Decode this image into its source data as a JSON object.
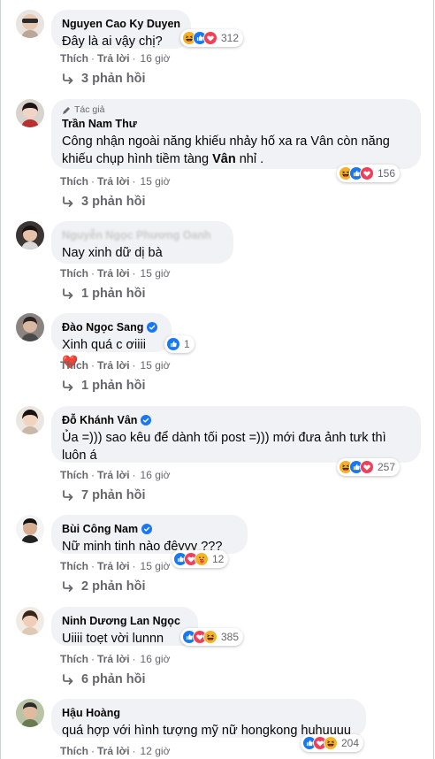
{
  "labels": {
    "like": "Thích",
    "reply": "Trả lời",
    "dot": "·",
    "author_tag": "Tác giả"
  },
  "colors": {
    "bubble": "#f0f2f5",
    "link": "#65676b",
    "verified": "#1877f2",
    "like": "#1877f2",
    "love": "#f33e58",
    "haha": "#f7b125"
  },
  "comments": [
    {
      "author": "Nguyen Cao Ky Duyen",
      "verified": false,
      "text": "Đây là ai vậy chị?",
      "reactions": [
        "haha",
        "like",
        "love"
      ],
      "reaction_count": "312",
      "time": "16 giờ",
      "replies": "3 phản hồi"
    },
    {
      "author": "Trần Nam Thư",
      "is_author": true,
      "verified": false,
      "text_line1": "Công nhận ngoài năng khiếu nhảy hố xa ra Vân còn năng",
      "text_line2_pre": "khiếu chụp hình tiềm tàng ",
      "text_line2_bold": "Vân",
      "text_line2_post": " nhỉ .",
      "reactions": [
        "haha",
        "like",
        "love"
      ],
      "reaction_count": "156",
      "time": "15 giờ",
      "replies": "3 phản hồi"
    },
    {
      "author": "Nguyễn Ngọc Phương Oanh",
      "blurred": true,
      "text": "Nay xinh dữ dị bà",
      "time": "15 giờ",
      "replies": "1 phản hồi"
    },
    {
      "author": "Đào Ngọc Sang",
      "verified": true,
      "text": "Xinh quá c ơiiii",
      "trailing_emoji": "❤️",
      "reactions": [
        "like"
      ],
      "reaction_count": "1",
      "time": "15 giờ",
      "replies": "1 phản hồi"
    },
    {
      "author": "Đỗ Khánh Vân",
      "verified": true,
      "text_line1": "Ủa =))) sao kêu để dành tối post =))) mới đưa ảnh tưk thì",
      "text_line2": "luôn á",
      "reactions": [
        "haha",
        "like",
        "love"
      ],
      "reaction_count": "257",
      "time": "16 giờ",
      "replies": "7 phản hồi"
    },
    {
      "author": "Bùi Công Nam",
      "verified": true,
      "text": "Nữ minh tinh nào đêyyy ???",
      "reactions": [
        "like",
        "love",
        "care"
      ],
      "reaction_count": "12",
      "time": "15 giờ",
      "replies": "2 phản hồi"
    },
    {
      "author": "Ninh Dương Lan Ngọc",
      "verified": false,
      "text": "Uiiii toẹt vời lunnn",
      "reactions": [
        "like",
        "love",
        "haha"
      ],
      "reaction_count": "385",
      "time": "16 giờ",
      "replies": "6 phản hồi"
    },
    {
      "author": "Hậu Hoàng",
      "verified": false,
      "text": "quá hợp với hình tượng mỹ nữ hongkong huhuuuu",
      "reactions": [
        "like",
        "love",
        "haha"
      ],
      "reaction_count": "204",
      "time": "12 giờ"
    }
  ]
}
